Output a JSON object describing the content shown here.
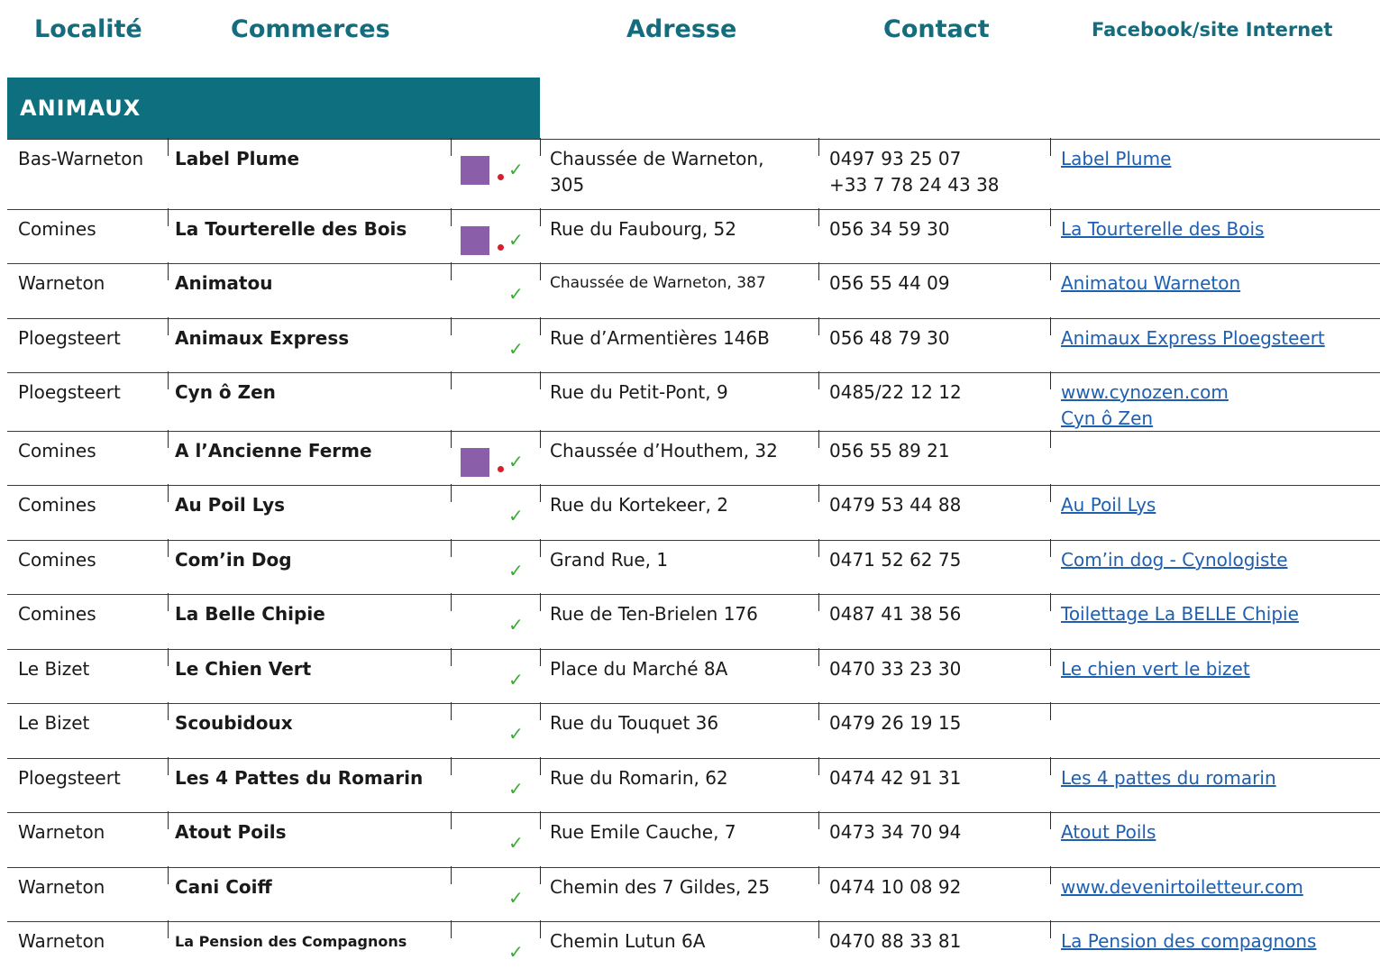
{
  "headers": {
    "localite": "Localité",
    "commerces": "Commerces",
    "adresse": "Adresse",
    "contact": "Contact",
    "web": "Facebook/site Internet"
  },
  "section": {
    "title": "ANIMAUX",
    "color": "#0e6f7e"
  },
  "colors": {
    "heading": "#156c7c",
    "link": "#1f5fb0",
    "purple_badge": "#8a5ea8",
    "red_dot": "#d81e28",
    "green_check": "#3daa37"
  },
  "icon_names": {
    "purple": "purple-square-icon",
    "dot": "red-dot-icon",
    "check": "green-check-icon"
  },
  "check_glyph": "✓",
  "rows": [
    {
      "localite": "Bas-Warneton",
      "name": "Label Plume",
      "badges": [
        "purple",
        "dot",
        "check"
      ],
      "address": [
        "Chaussée de Warneton,",
        "305"
      ],
      "contact": [
        "0497 93 25 07",
        "+33 7 78 24 43 38"
      ],
      "web": [
        "Label Plume"
      ]
    },
    {
      "localite": "Comines",
      "name": "La Tourterelle des Bois",
      "badges": [
        "purple",
        "dot",
        "check"
      ],
      "address": [
        "Rue du Faubourg, 52"
      ],
      "contact": [
        "056 34 59 30"
      ],
      "web": [
        "La Tourterelle des Bois"
      ]
    },
    {
      "localite": "Warneton",
      "name": "Animatou",
      "badges": [
        "check"
      ],
      "address": [
        "Chaussée de Warneton, 387"
      ],
      "address_small": true,
      "contact": [
        "056 55 44 09"
      ],
      "web": [
        "Animatou Warneton"
      ]
    },
    {
      "localite": "Ploegsteert",
      "name": "Animaux Express",
      "badges": [
        "check"
      ],
      "address": [
        "Rue d’Armentières 146B"
      ],
      "contact": [
        "056 48 79 30"
      ],
      "web": [
        "Animaux Express Ploegsteert"
      ]
    },
    {
      "localite": "Ploegsteert",
      "name": "Cyn ô Zen",
      "badges": [],
      "address": [
        "Rue du Petit-Pont, 9"
      ],
      "contact": [
        "0485/22 12 12"
      ],
      "web": [
        "www.cynozen.com",
        "Cyn ô Zen"
      ]
    },
    {
      "localite": "Comines",
      "name": "A l’Ancienne Ferme",
      "badges": [
        "purple",
        "dot",
        "check"
      ],
      "address": [
        "Chaussée d’Houthem, 32"
      ],
      "contact": [
        "056 55 89 21"
      ],
      "web": []
    },
    {
      "localite": "Comines",
      "name": "Au Poil Lys",
      "badges": [
        "check"
      ],
      "address": [
        "Rue du Kortekeer, 2"
      ],
      "contact": [
        "0479 53 44 88"
      ],
      "web": [
        "Au Poil Lys"
      ]
    },
    {
      "localite": "Comines",
      "name": "Com’in Dog",
      "badges": [
        "check"
      ],
      "address": [
        "Grand Rue, 1"
      ],
      "contact": [
        "0471 52 62 75"
      ],
      "web": [
        "Com’in dog - Cynologiste"
      ]
    },
    {
      "localite": "Comines",
      "name": "La Belle Chipie",
      "badges": [
        "check"
      ],
      "address": [
        "Rue de Ten-Brielen 176"
      ],
      "contact": [
        "0487 41 38 56"
      ],
      "web": [
        "Toilettage La BELLE Chipie"
      ]
    },
    {
      "localite": "Le Bizet",
      "name": "Le Chien Vert",
      "badges": [
        "check"
      ],
      "address": [
        "Place du Marché 8A"
      ],
      "contact": [
        "0470 33 23 30"
      ],
      "web": [
        "Le chien vert le bizet"
      ]
    },
    {
      "localite": "Le Bizet",
      "name": "Scoubidoux",
      "badges": [
        "check"
      ],
      "address": [
        "Rue du Touquet 36"
      ],
      "contact": [
        "0479 26 19 15"
      ],
      "web": []
    },
    {
      "localite": "Ploegsteert",
      "name": "Les 4 Pattes du Romarin",
      "badges": [
        "check"
      ],
      "address": [
        "Rue du Romarin, 62"
      ],
      "contact": [
        "0474 42 91 31"
      ],
      "web": [
        "Les 4 pattes du romarin"
      ]
    },
    {
      "localite": "Warneton",
      "name": "Atout Poils",
      "badges": [
        "check"
      ],
      "address": [
        "Rue Emile Cauche, 7"
      ],
      "contact": [
        "0473 34 70 94"
      ],
      "web": [
        "Atout Poils"
      ]
    },
    {
      "localite": "Warneton",
      "name": "Cani Coiff",
      "badges": [
        "check"
      ],
      "address": [
        "Chemin des 7 Gildes, 25"
      ],
      "contact": [
        "0474 10 08 92"
      ],
      "web": [
        "www.devenirtoiletteur.com"
      ]
    },
    {
      "localite": "Warneton",
      "name": "La Pension des Compagnons",
      "name_small": true,
      "badges": [
        "check"
      ],
      "address": [
        "Chemin Lutun 6A"
      ],
      "contact": [
        "0470 88 33 81"
      ],
      "web": [
        "La Pension des compagnons"
      ]
    }
  ]
}
